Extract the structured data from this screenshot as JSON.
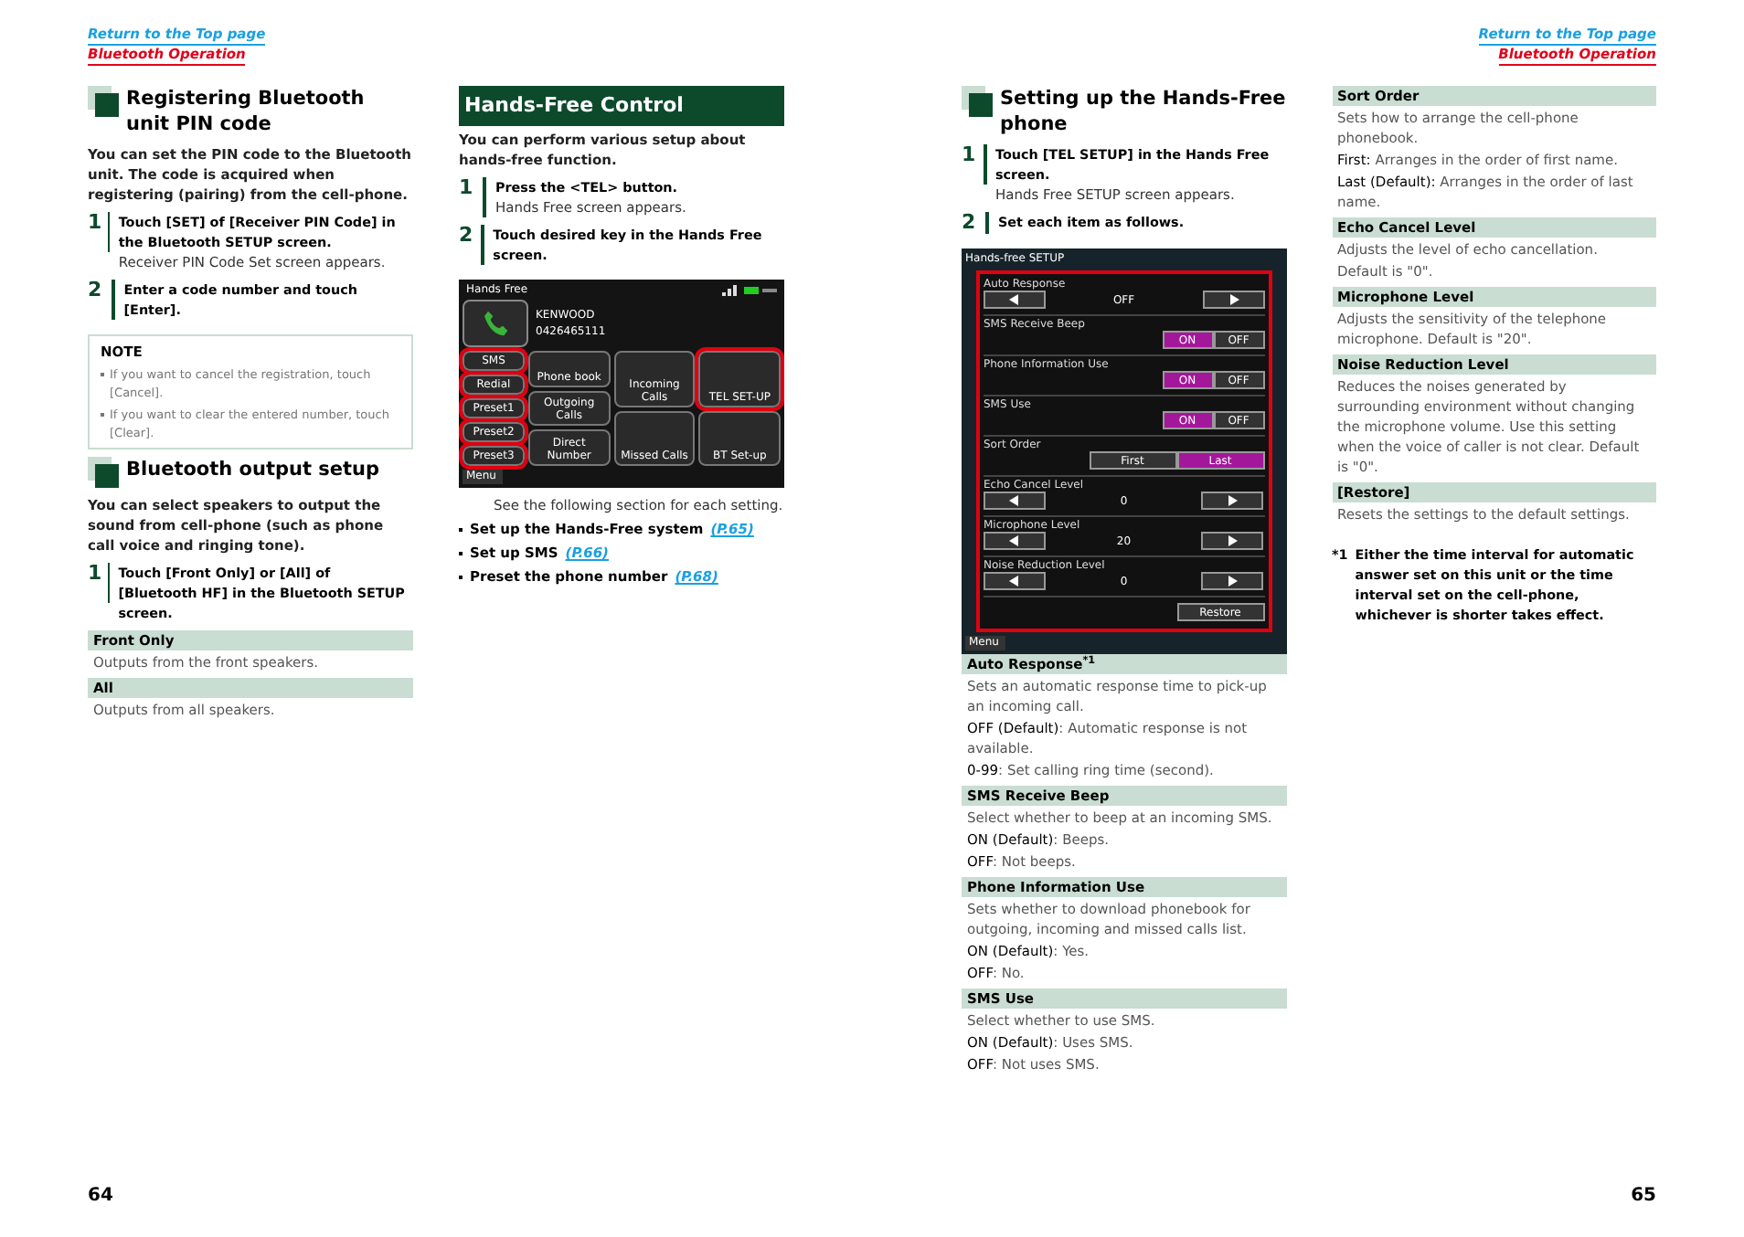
{
  "pages": [
    {
      "kind": "left",
      "header_links": [
        {
          "text": "Return to the Top page",
          "kind": "top"
        },
        {
          "text": "Bluetooth Operation",
          "kind": "section"
        }
      ],
      "page_number": "64",
      "columns": [
        [
          {
            "kind": "heading",
            "text": "Registering Bluetooth unit PIN code"
          },
          {
            "kind": "para",
            "text": "You can set the PIN code to the Bluetooth unit. The code is acquired when registering (pairing) from the cell-phone."
          },
          {
            "kind": "step",
            "number": "1",
            "instruction": "Touch [SET] of [Receiver PIN Code] in the Bluetooth SETUP screen.",
            "result": "Receiver PIN Code Set screen appears."
          },
          {
            "kind": "step",
            "number": "2",
            "instruction": "Enter a code number and touch [Enter]."
          },
          {
            "kind": "note",
            "title": "NOTE",
            "items": [
              "If you want to cancel the registration, touch [Cancel].",
              "If you want to clear the entered number, touch [Clear]."
            ]
          },
          {
            "kind": "heading",
            "text": "Bluetooth output setup"
          },
          {
            "kind": "para",
            "text": "You can select speakers to output the sound from cell-phone (such as phone call voice and ringing tone)."
          },
          {
            "kind": "step",
            "number": "1",
            "instruction": "Touch [Front Only] or [All] of [Bluetooth HF] in the Bluetooth SETUP screen."
          },
          {
            "kind": "item",
            "title": "Front Only",
            "lines": [
              "Outputs from the front speakers."
            ]
          },
          {
            "kind": "item",
            "title": "All",
            "lines": [
              "Outputs from all speakers."
            ]
          }
        ],
        [
          {
            "kind": "banner",
            "text": "Hands-Free Control"
          },
          {
            "kind": "para",
            "text": "You can perform various setup about hands-free function."
          },
          {
            "kind": "step",
            "number": "1",
            "instruction": "Press the <TEL> button.",
            "result": "Hands Free screen appears."
          },
          {
            "kind": "step",
            "number": "2",
            "instruction": "Touch desired key in the Hands Free screen."
          },
          {
            "kind": "hands_free_screen",
            "title": "Hands Free",
            "name": "KENWOOD",
            "number": "0426465111",
            "menu": "Menu",
            "key_columns": [
              [
                {
                  "label": "SMS",
                  "highlighted": true
                },
                {
                  "label": "Redial",
                  "highlighted": true
                },
                {
                  "label": "Preset1",
                  "highlighted": true
                },
                {
                  "label": "Preset2",
                  "highlighted": true
                },
                {
                  "label": "Preset3",
                  "highlighted": true
                }
              ],
              [
                {
                  "label": "Phone book",
                  "highlighted": false
                },
                {
                  "label": "Outgoing Calls",
                  "highlighted": false
                },
                {
                  "label": "Direct Number",
                  "highlighted": false
                }
              ],
              [
                {
                  "label": "Incoming Calls",
                  "highlighted": false
                },
                {
                  "label": "Missed Calls",
                  "highlighted": false
                }
              ],
              [
                {
                  "label": "TEL SET-UP",
                  "highlighted": true
                },
                {
                  "label": "BT Set-up",
                  "highlighted": false
                }
              ]
            ]
          },
          {
            "kind": "plain",
            "text": "See the following section for each setting."
          },
          {
            "kind": "bullets",
            "items": [
              {
                "text": "Set up the Hands-Free system",
                "link": "(P.65)"
              },
              {
                "text": "Set up SMS",
                "link": "(P.66)"
              },
              {
                "text": "Preset the phone number",
                "link": "(P.68)"
              }
            ]
          }
        ]
      ]
    },
    {
      "kind": "right",
      "header_links": [
        {
          "text": "Return to the Top page",
          "kind": "top"
        },
        {
          "text": "Bluetooth Operation",
          "kind": "section"
        }
      ],
      "page_number": "65",
      "columns": [
        [
          {
            "kind": "heading",
            "text": "Setting up the Hands-Free phone"
          },
          {
            "kind": "step",
            "number": "1",
            "instruction": "Touch [TEL SETUP] in the Hands Free screen.",
            "result": "Hands Free SETUP screen appears."
          },
          {
            "kind": "step",
            "number": "2",
            "instruction": "Set each item as follows."
          },
          {
            "kind": "setup_screen",
            "title": "Hands-free SETUP",
            "menu": "Menu",
            "rows": [
              {
                "kind": "stepper",
                "label": "Auto Response",
                "value": "OFF"
              },
              {
                "kind": "choice",
                "label": "SMS Receive Beep",
                "options": [
                  {
                    "label": "ON",
                    "selected": true
                  },
                  {
                    "label": "OFF",
                    "selected": false
                  }
                ]
              },
              {
                "kind": "choice",
                "label": "Phone Information Use",
                "options": [
                  {
                    "label": "ON",
                    "selected": true
                  },
                  {
                    "label": "OFF",
                    "selected": false
                  }
                ]
              },
              {
                "kind": "choice",
                "label": "SMS Use",
                "options": [
                  {
                    "label": "ON",
                    "selected": true
                  },
                  {
                    "label": "OFF",
                    "selected": false
                  }
                ]
              },
              {
                "kind": "choice",
                "label": "Sort Order",
                "options": [
                  {
                    "label": "First",
                    "selected": false
                  },
                  {
                    "label": "Last",
                    "selected": true
                  }
                ]
              },
              {
                "kind": "stepper",
                "label": "Echo Cancel Level",
                "value": "0"
              },
              {
                "kind": "stepper",
                "label": "Microphone Level",
                "value": "20"
              },
              {
                "kind": "stepper",
                "label": "Noise Reduction Level",
                "value": "0"
              },
              {
                "kind": "button",
                "label": "Restore"
              }
            ]
          },
          {
            "kind": "item",
            "title": "Auto Response$^{*1}$",
            "lines": [
              "Sets an automatic response time to pick-up an incoming call.",
              "**OFF (Default)**: Automatic response is not available.",
              "**0-99**: Set calling ring time (second)."
            ]
          },
          {
            "kind": "item",
            "title": "SMS Receive Beep",
            "lines": [
              "Select whether to beep at an incoming SMS.",
              "**ON (Default)**: Beeps.",
              "**OFF**: Not beeps."
            ]
          },
          {
            "kind": "item",
            "title": "Phone Information Use",
            "lines": [
              "Sets whether to download phonebook for outgoing, incoming and missed calls list.",
              "**ON (Default)**: Yes.",
              "**OFF**: No."
            ]
          },
          {
            "kind": "item",
            "title": "SMS Use",
            "lines": [
              "Select whether to use SMS.",
              "**ON (Default)**: Uses SMS.",
              "**OFF**: Not uses SMS."
            ]
          }
        ],
        [
          {
            "kind": "item",
            "title": "Sort Order",
            "lines": [
              "Sets how to arrange the cell-phone phonebook.",
              "**First:** Arranges in the order of first name.",
              "**Last (Default):** Arranges in the order of last name."
            ]
          },
          {
            "kind": "item",
            "title": "Echo Cancel Level",
            "lines": [
              "Adjusts the level of echo cancellation.",
              "Default is \"0\"."
            ]
          },
          {
            "kind": "item",
            "title": "Microphone Level",
            "lines": [
              "Adjusts the sensitivity of the telephone microphone. Default is \"20\"."
            ]
          },
          {
            "kind": "item",
            "title": "Noise Reduction Level",
            "lines": [
              "Reduces the noises generated by surrounding environment without changing the microphone volume. Use this setting when the voice of caller is not clear. Default is \"0\"."
            ]
          },
          {
            "kind": "item",
            "title": "[Restore]",
            "lines": [
              "Resets the settings to the default settings."
            ]
          },
          {
            "kind": "footnote",
            "mark": "*1",
            "text": "Either the time interval for automatic answer set on this unit or the time interval set on the cell-phone, whichever is shorter takes effect."
          }
        ]
      ]
    }
  ]
}
